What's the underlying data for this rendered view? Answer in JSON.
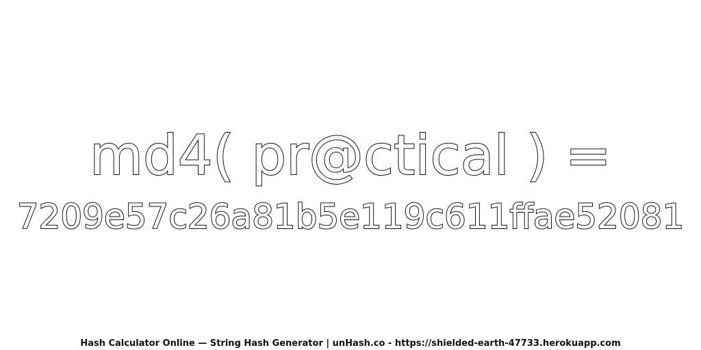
{
  "headline": {
    "expression": "md4( pr@ctical ) =",
    "hash": "7209e57c26a81b5e119c611ffae52081"
  },
  "footer": {
    "text": "Hash Calculator Online — String Hash Generator | unHash.co - https://shielded-earth-47733.herokuapp.com"
  },
  "colors": {
    "background": "#ffffff",
    "outline": "#111111",
    "fill": "#ffffff"
  }
}
